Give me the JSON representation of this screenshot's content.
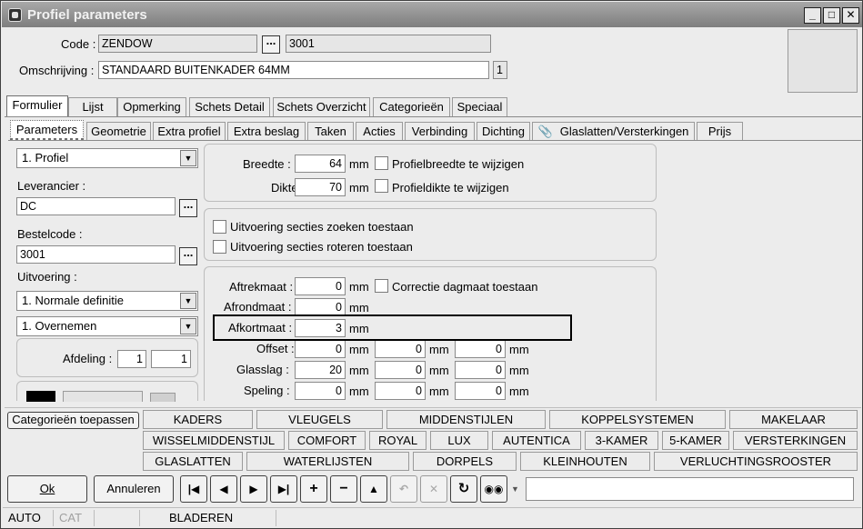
{
  "window": {
    "title": "Profiel parameters"
  },
  "header": {
    "code_label": "Code :",
    "code_value": "ZENDOW",
    "code_dots": "...",
    "code_number": "3001",
    "omschrijving_label": "Omschrijving :",
    "omschrijving_value": "STANDAARD BUITENKADER 64MM",
    "omschrijving_badge": "1"
  },
  "tabs_main": [
    "Formulier",
    "Lijst",
    "Opmerking",
    "Schets Detail",
    "Schets Overzicht",
    "Categorieën",
    "Speciaal"
  ],
  "tabs_sub": [
    "Parameters",
    "Geometrie",
    "Extra profiel",
    "Extra beslag",
    "Taken",
    "Acties",
    "Verbinding",
    "Dichting",
    "Glaslatten/Versterkingen",
    "Prijs"
  ],
  "left": {
    "profiel_select": "1.  Profiel",
    "leverancier_label": "Leverancier :",
    "leverancier_value": "DC",
    "bestelcode_label": "Bestelcode :",
    "bestelcode_value": "3001",
    "uitvoering_label": "Uitvoering :",
    "uitvoering_select": "1.  Normale definitie",
    "overnemen_select": "1.  Overnemen",
    "afdeling_label": "Afdeling :",
    "afdeling_1": "1",
    "afdeling_2": "1",
    "dots": "..."
  },
  "dims": {
    "breedte_label": "Breedte :",
    "breedte_value": "64",
    "breedte_unit": "mm",
    "breedte_check": "Profielbreedte te wijzigen",
    "dikte_label": "Dikte :",
    "dikte_value": "70",
    "dikte_unit": "mm",
    "dikte_check": "Profieldikte te wijzigen"
  },
  "options": {
    "zoeken": "Uitvoering secties zoeken toestaan",
    "roteren": "Uitvoering secties roteren toestaan"
  },
  "maten": {
    "aftrek_label": "Aftrekmaat :",
    "aftrek_value": "0",
    "correctie_check": "Correctie dagmaat toestaan",
    "afrond_label": "Afrondmaat :",
    "afrond_value": "0",
    "afkort_label": "Afkortmaat :",
    "afkort_value": "3",
    "offset_label": "Offset :",
    "offset_values": [
      "0",
      "0",
      "0"
    ],
    "glasslag_label": "Glasslag :",
    "glasslag_values": [
      "20",
      "0",
      "0"
    ],
    "speling_label": "Speling :",
    "speling_values": [
      "0",
      "0",
      "0"
    ],
    "unit": "mm"
  },
  "categories": {
    "apply_button": "Categorieën toepassen",
    "row1": [
      "KADERS",
      "VLEUGELS",
      "MIDDENSTIJLEN",
      "KOPPELSYSTEMEN",
      "MAKELAAR"
    ],
    "row2": [
      "WISSELMIDDENSTIJL",
      "COMFORT",
      "ROYAL",
      "LUX",
      "AUTENTICA",
      "3-KAMER",
      "5-KAMER",
      "VERSTERKINGEN"
    ],
    "row3": [
      "GLASLATTEN",
      "WATERLIJSTEN",
      "DORPELS",
      "KLEINHOUTEN",
      "VERLUCHTINGSROOSTER"
    ]
  },
  "buttons": {
    "ok": "Ok",
    "annuleren": "Annuleren"
  },
  "nav_icons": [
    "first-icon",
    "prev-icon",
    "next-icon",
    "last-icon",
    "add-icon",
    "remove-icon",
    "up-icon",
    "undo-icon",
    "cancel-icon",
    "refresh-icon",
    "search-icon"
  ],
  "status": {
    "mode": "AUTO",
    "cat": "CAT",
    "state": "BLADEREN"
  },
  "colors": {
    "highlight_border": "#000000",
    "swatch": "#000000"
  }
}
